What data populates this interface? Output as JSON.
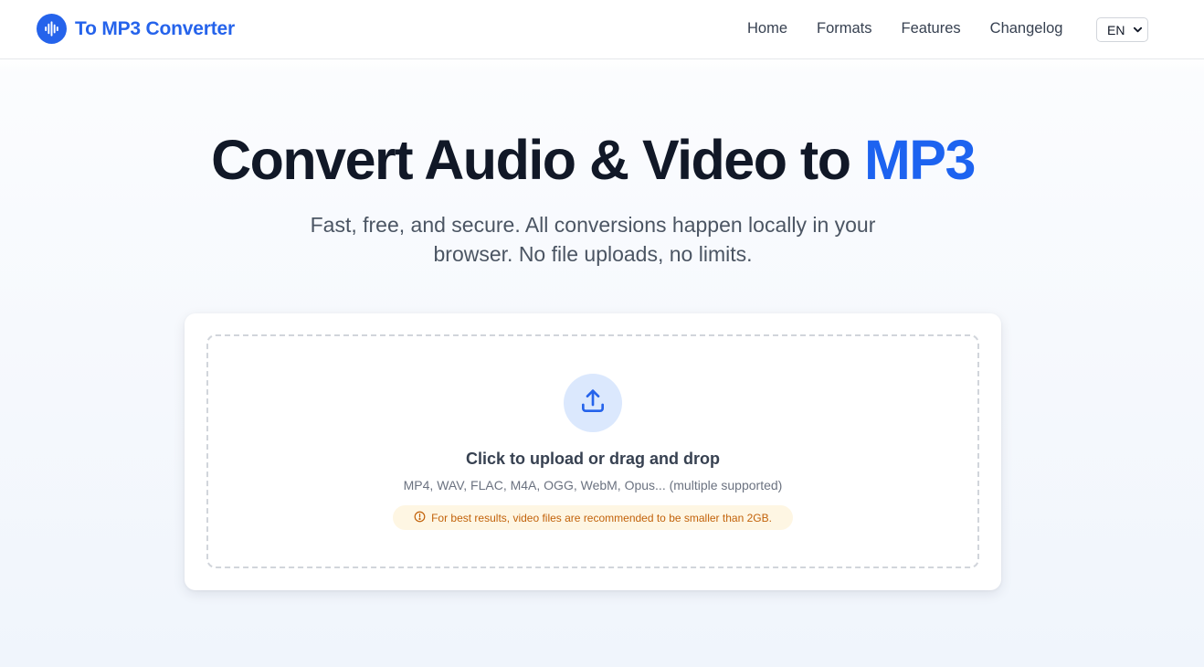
{
  "header": {
    "logo_text": "To MP3 Converter",
    "nav": [
      "Home",
      "Formats",
      "Features",
      "Changelog"
    ],
    "language": "EN"
  },
  "hero": {
    "title_main": "Convert Audio & Video to",
    "title_accent": "MP3",
    "subtitle": "Fast, free, and secure. All conversions happen locally in your browser. No file uploads, no limits."
  },
  "upload": {
    "title": "Click to upload or drag and drop",
    "formats": "MP4, WAV, FLAC, M4A, OGG, WebM, Opus... (multiple supported)",
    "warning": "For best results, video files are recommended to be smaller than 2GB."
  },
  "icons": {
    "logo": "audio-waveform-icon",
    "upload": "upload-icon",
    "warning": "info-circle-icon",
    "language_dropdown": "chevron-down-icon"
  },
  "colors": {
    "brand": "#2563eb",
    "title_accent": "#1d63f0",
    "upload_circle": "#dbe8fd",
    "warning_bg": "#fef6e3",
    "warning_text": "#c2620a"
  }
}
